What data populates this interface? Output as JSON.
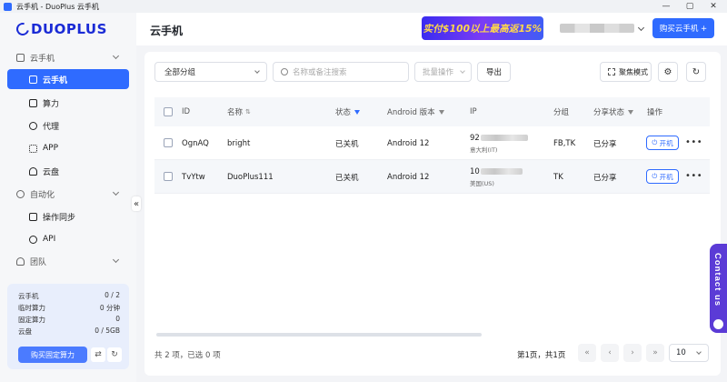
{
  "window": {
    "title": "云手机 - DuoPlus 云手机",
    "controls": [
      "—",
      "▢",
      "✕"
    ]
  },
  "sidebar": {
    "logo_text": "DUOPLUS",
    "groups": [
      {
        "label": "云手机",
        "items": [
          {
            "label": "云手机",
            "active": true
          },
          {
            "label": "算力"
          },
          {
            "label": "代理"
          },
          {
            "label": "APP"
          },
          {
            "label": "云盘"
          }
        ]
      },
      {
        "label": "自动化",
        "items": [
          {
            "label": "操作同步"
          },
          {
            "label": "API"
          }
        ]
      },
      {
        "label": "团队",
        "items": []
      }
    ],
    "collapse_icon": "«",
    "stats": [
      {
        "label": "云手机",
        "value": "0 / 2"
      },
      {
        "label": "临时算力",
        "value": "0 分钟"
      },
      {
        "label": "固定算力",
        "value": "0"
      },
      {
        "label": "云盘",
        "value": "0 / 5GB"
      }
    ],
    "buy_fixed_label": "购买固定算力",
    "exchange_icon": "⇄",
    "refresh_icon": "↻"
  },
  "header": {
    "title": "云手机",
    "promo_text": "实付$100以上最高返15%",
    "buy_button_label": "购买云手机 +"
  },
  "toolbar": {
    "group_select": "全部分组",
    "search_placeholder": "名称或备注搜索",
    "batch_label": "批量操作",
    "export_label": "导出",
    "focus_mode_label": "聚焦模式",
    "settings_icon": "⚙",
    "refresh_icon": "↻"
  },
  "table": {
    "columns": {
      "id": "ID",
      "name": "名称",
      "status": "状态",
      "android": "Android 版本",
      "ip": "IP",
      "group": "分组",
      "share": "分享状态",
      "ops": "操作"
    },
    "rows": [
      {
        "id": "OgnAQ",
        "name": "bright",
        "status": "已关机",
        "android": "Android 12",
        "ip_prefix": "92",
        "ip_region": "意大利(IT)",
        "group": "FB,TK",
        "share": "已分享",
        "power_label": "开机",
        "more": "•••"
      },
      {
        "id": "TvYtw",
        "name": "DuoPlus111",
        "status": "已关机",
        "android": "Android 12",
        "ip_prefix": "10",
        "ip_region": "美国(US)",
        "group": "TK",
        "share": "已分享",
        "power_label": "开机",
        "more": "•••"
      }
    ]
  },
  "footer": {
    "summary": "共 2 项，已选 0 项",
    "page_info": "第1页，共1页",
    "page_size": "10",
    "first_icon": "«",
    "prev_icon": "‹",
    "next_icon": "›",
    "last_icon": "»"
  },
  "contact_tab": {
    "label": "Contact us"
  }
}
